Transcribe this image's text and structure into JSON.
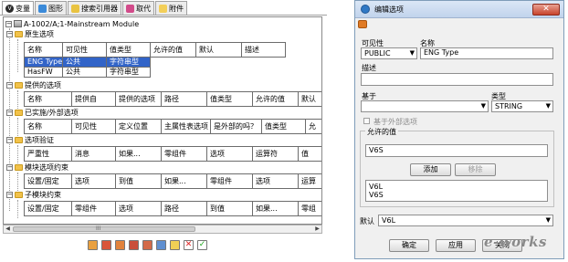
{
  "tabs": [
    {
      "label": "变量",
      "icon": "variable-icon",
      "active": true
    },
    {
      "label": "图形",
      "icon": "graphics-icon",
      "active": false
    },
    {
      "label": "搜索引用器",
      "icon": "search-reference-icon",
      "active": false
    },
    {
      "label": "取代",
      "icon": "replace-icon",
      "active": false
    },
    {
      "label": "附件",
      "icon": "attachment-icon",
      "active": false
    }
  ],
  "tree": {
    "root": "A-1002/A;1-Mainstream Module",
    "sections": [
      {
        "label": "原生选项",
        "headers": [
          "名称",
          "可见性",
          "值类型",
          "允许的值",
          "默认",
          "描述"
        ],
        "rows": [
          [
            "ENG Type",
            "公共",
            "字符串型",
            "",
            "",
            ""
          ],
          [
            "HasFW",
            "公共",
            "字符串型",
            "",
            "",
            ""
          ]
        ]
      },
      {
        "label": "提供的选项",
        "headers": [
          "名称",
          "提供自",
          "提供的选项",
          "路径",
          "值类型",
          "允许的值",
          "默认"
        ]
      },
      {
        "label": "已实施/外部选项",
        "headers": [
          "名称",
          "可见性",
          "定义位置",
          "主属性表选项",
          "是外部的吗？",
          "值类型",
          "允"
        ]
      },
      {
        "label": "选项验证",
        "headers": [
          "严重性",
          "消息",
          "如果...",
          "零组件",
          "选项",
          "运算符",
          "值"
        ]
      },
      {
        "label": "模块选项约束",
        "headers": [
          "设置/固定",
          "选项",
          "到值",
          "如果...",
          "零组件",
          "选项",
          "运算"
        ]
      },
      {
        "label": "子模块约束",
        "headers": [
          "设置/固定",
          "零组件",
          "选项",
          "路径",
          "到值",
          "如果...",
          "零组"
        ]
      }
    ]
  },
  "scroll_marker": "III",
  "bottom_toolbar_icons": [
    "add-option-icon",
    "edit-option-icon",
    "copy-option-icon",
    "paste-option-icon",
    "move-option-icon",
    "view-option-icon",
    "edit-pencil-icon",
    "delete-icon",
    "check-icon"
  ],
  "dialog": {
    "title": "编辑选项",
    "visibility_label": "可见性",
    "visibility_value": "PUBLIC",
    "name_label": "名称",
    "name_value": "ENG Type",
    "description_label": "描述",
    "description_value": "",
    "based_on_label": "基于",
    "based_on_value": "",
    "type_label": "类型",
    "type_value": "STRING",
    "external_checkbox_label": "基于外部选项",
    "allowed_values_group": "允许的值",
    "allowed_value_input": "V6S",
    "add_button": "添加",
    "remove_button": "移除",
    "allowed_values_list": [
      "V6L",
      "V6S"
    ],
    "default_label": "默认",
    "default_value": "V6L",
    "ok_button": "确定",
    "apply_button": "应用",
    "close_button": "关闭",
    "watermark": "e-works"
  }
}
